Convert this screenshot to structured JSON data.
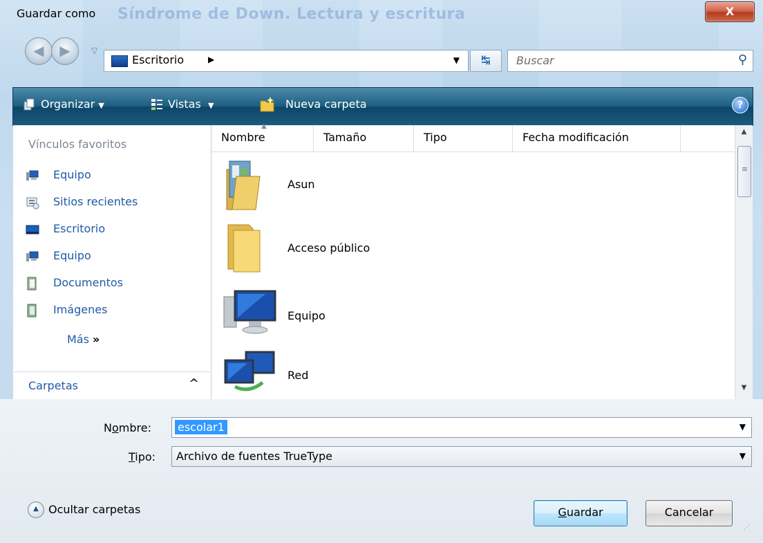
{
  "window": {
    "title": "Guardar como",
    "ghost_title": "Síndrome de Down. Lectura y escritura",
    "close_glyph": "X"
  },
  "address": {
    "location": "Escritorio",
    "search_placeholder": "Buscar"
  },
  "toolbar": {
    "organize": "Organizar",
    "views": "Vistas",
    "new_folder": "Nueva carpeta"
  },
  "sidebar": {
    "heading": "Vínculos favoritos",
    "items": [
      {
        "label": "Equipo",
        "icon": "computer-icon"
      },
      {
        "label": "Sitios recientes",
        "icon": "recent-places-icon"
      },
      {
        "label": "Escritorio",
        "icon": "desktop-icon"
      },
      {
        "label": "Equipo",
        "icon": "computer-icon"
      },
      {
        "label": "Documentos",
        "icon": "documents-icon"
      },
      {
        "label": "Imágenes",
        "icon": "pictures-icon"
      }
    ],
    "more": "Más",
    "folders": "Carpetas"
  },
  "columns": [
    "Nombre",
    "Tamaño",
    "Tipo",
    "Fecha modificación"
  ],
  "files": [
    {
      "name": "Asun",
      "icon": "user-folder-icon"
    },
    {
      "name": "Acceso público",
      "icon": "folder-icon"
    },
    {
      "name": "Equipo",
      "icon": "computer-icon"
    },
    {
      "name": "Red",
      "icon": "network-icon"
    }
  ],
  "footer": {
    "name_label_pre": "N",
    "name_label_u": "o",
    "name_label_post": "mbre:",
    "name_value": "escolar1",
    "type_label_u": "T",
    "type_label_post": "ipo:",
    "type_value": "Archivo de fuentes TrueType",
    "hide_folders": "Ocultar carpetas",
    "save_u": "G",
    "save_post": "uardar",
    "cancel": "Cancelar"
  },
  "colors": {
    "toolbar": "#1d5f82",
    "link": "#1f5aa6",
    "selection": "#3399ff"
  }
}
